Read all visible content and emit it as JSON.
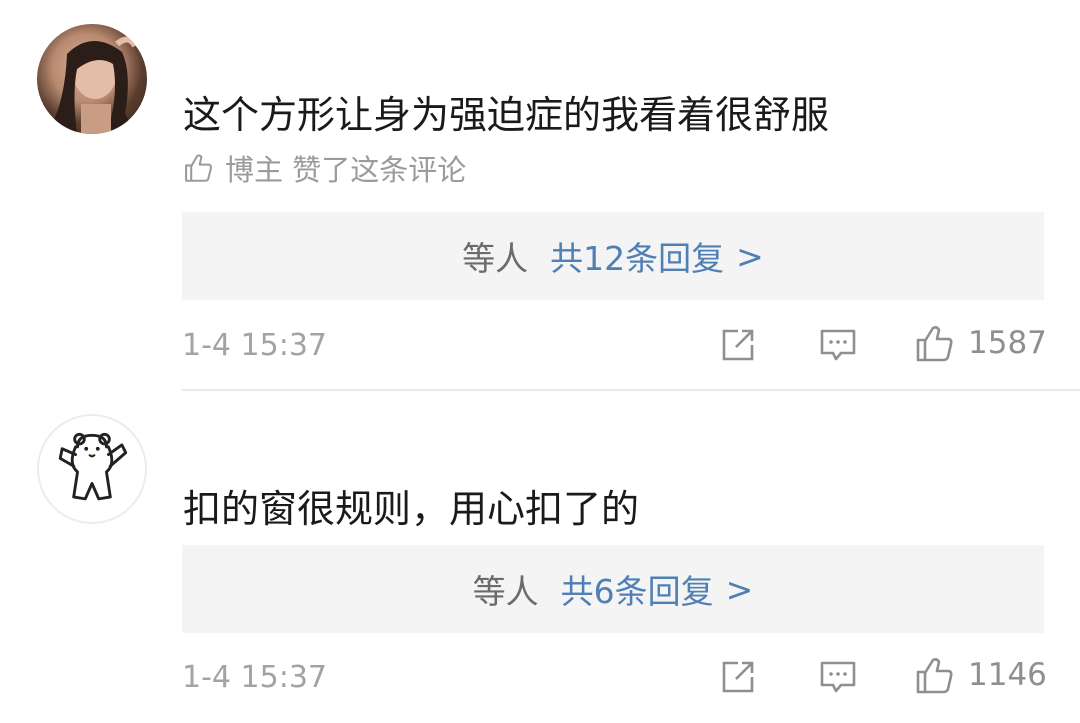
{
  "comments": [
    {
      "avatar": "avatar-portrait-photo",
      "text": "这个方形让身为强迫症的我看着很舒服",
      "liked_by_author": "博主 赞了这条评论",
      "replies_who": "等人",
      "replies_link": "共12条回复",
      "replies_arrow": ">",
      "time": "1-4 15:37",
      "likes": "1587"
    },
    {
      "avatar": "avatar-bear-cartoon",
      "text": "扣的窗很规则，用心扣了的",
      "replies_who": "等人",
      "replies_link": "共6条回复",
      "replies_arrow": ">",
      "time": "1-4 15:37",
      "likes": "1146"
    }
  ],
  "icons": {
    "share": "share-icon",
    "comment": "comment-icon",
    "like": "thumbs-up-icon"
  },
  "colors": {
    "link": "#4f7fb5",
    "muted": "#9b9b9b",
    "reply_bg": "#f4f4f4"
  }
}
